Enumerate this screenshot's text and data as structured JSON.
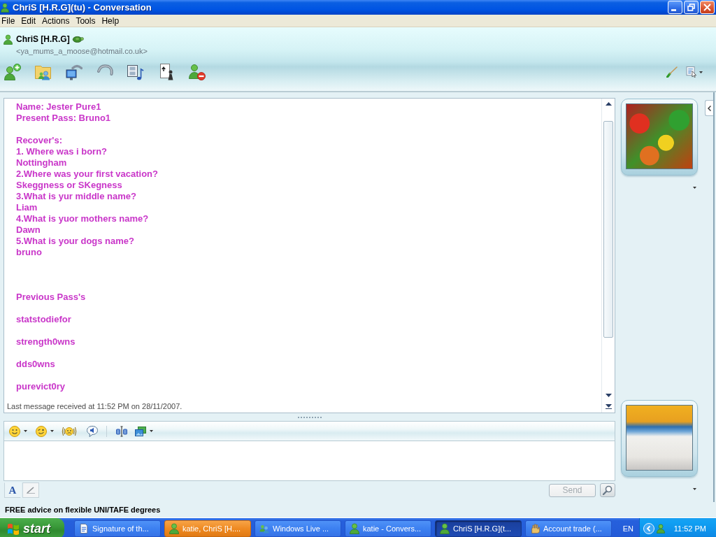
{
  "window": {
    "title": "ChriS [H.R.G](tu) - Conversation"
  },
  "menu": [
    {
      "label": "File"
    },
    {
      "label": "Edit"
    },
    {
      "label": "Actions"
    },
    {
      "label": "Tools"
    },
    {
      "label": "Help"
    }
  ],
  "contact": {
    "name": "ChriS [H.R.G]",
    "email": "<ya_mums_a_moose@hotmail.co.uk>"
  },
  "conversation": {
    "message": "Name: Jester Pure1\nPresent Pass: Bruno1\n\nRecover's:\n1. Where was i born?\nNottingham\n2.Where was your first vacation?\nSkeggness or SKegness\n3.What is yur middle name?\nLiam\n4.What is yuor mothers name?\nDawn\n5.What is your dogs name?\nbruno\n\n\n\nPrevious Pass's\n\nstatstodiefor\n\nstrength0wns\n\ndds0wns\n\npurevict0ry",
    "status": "Last message received at 11:52 PM on 28/11/2007."
  },
  "compose": {
    "modes": [
      {
        "kind": "text",
        "label": "A",
        "selected": true
      },
      {
        "kind": "handwriting",
        "selected": false
      }
    ],
    "send": {
      "label": "Send",
      "disabled": true
    }
  },
  "ad": "FREE advice on flexible UNI/TAFE degrees",
  "taskbar": {
    "start": "start",
    "tasks": [
      {
        "label": "Signature of th...",
        "selected": false,
        "flashing": false
      },
      {
        "label": "katie, ChriS [H....",
        "selected": false,
        "flashing": true
      },
      {
        "label": "Windows Live ...",
        "selected": false,
        "flashing": false
      },
      {
        "label": "katie - Convers...",
        "selected": false,
        "flashing": false
      },
      {
        "label": "ChriS [H.R.G](t...",
        "selected": true,
        "flashing": false
      },
      {
        "label": "Account trade (...",
        "selected": false,
        "flashing": false
      }
    ],
    "language": "EN",
    "clock": "11:52 PM"
  }
}
